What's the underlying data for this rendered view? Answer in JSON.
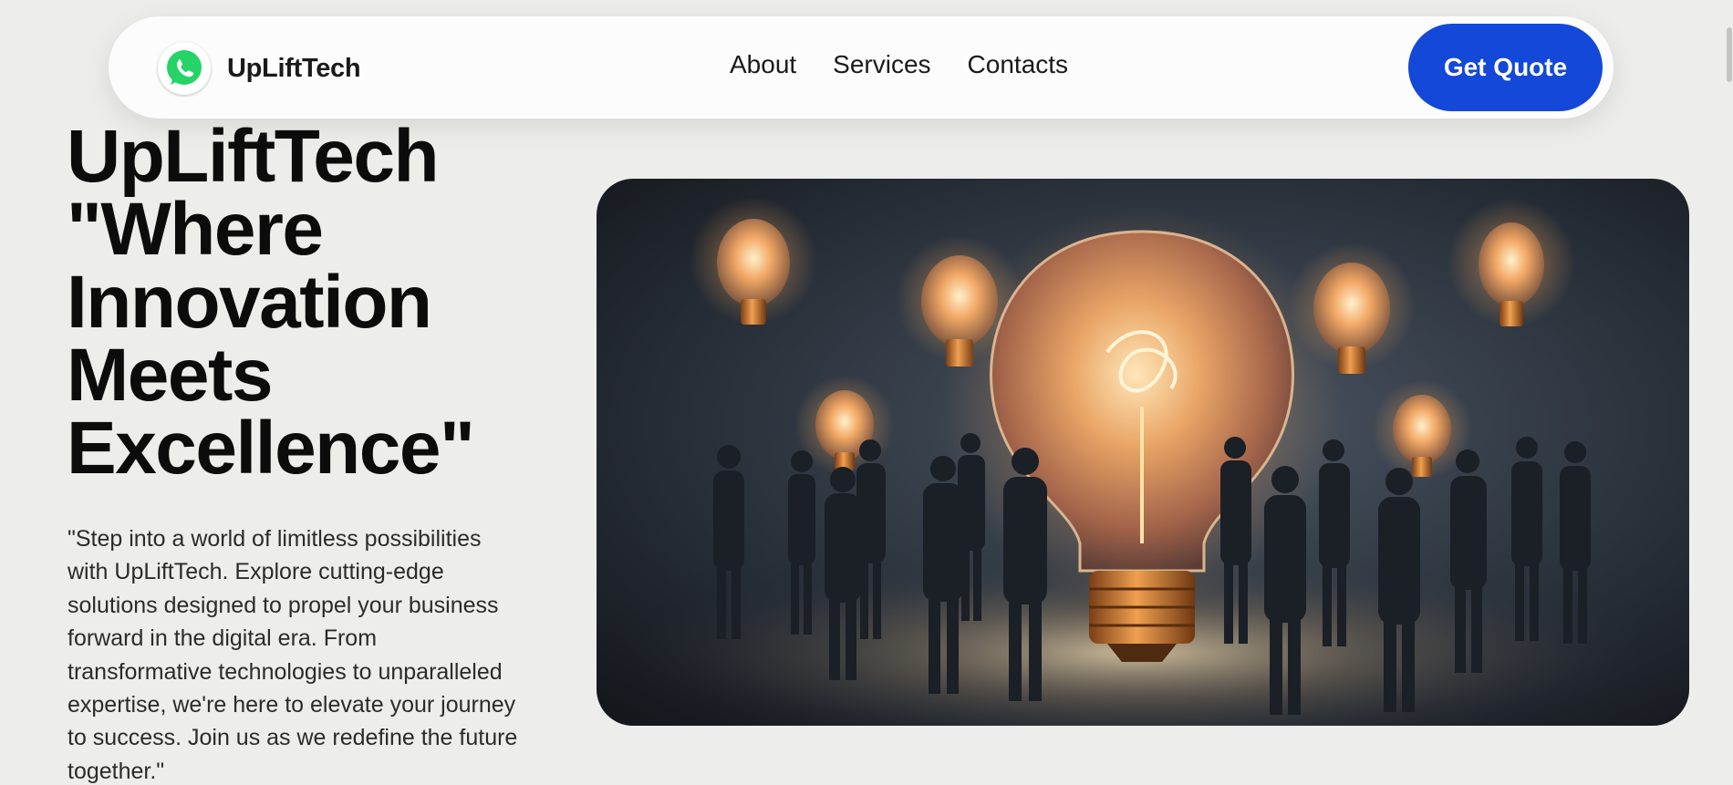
{
  "header": {
    "brand_name": "UpLiftTech",
    "logo_icon": "whatsapp-icon",
    "nav": [
      {
        "label": "About"
      },
      {
        "label": "Services"
      },
      {
        "label": "Contacts"
      }
    ],
    "cta_label": "Get Quote"
  },
  "hero": {
    "title_lines": [
      "UpLiftTech",
      "\"Where",
      "Innovation",
      "Meets",
      "Excellence\""
    ],
    "description": "\"Step into a world of limitless possibilities with UpLiftTech. Explore cutting-edge solutions designed to propel your business forward in the digital era. From transformative technologies to unparalleled expertise, we're here to elevate your journey to success. Join us as we redefine the future together.\"",
    "image_subject": "glowing-lightbulbs-people-illustration"
  },
  "colors": {
    "background": "#edeeeb",
    "navbar": "#fcfcfc",
    "accent": "#1448d8",
    "whatsapp_green": "#25d366",
    "text_primary": "#0c0c0c"
  }
}
